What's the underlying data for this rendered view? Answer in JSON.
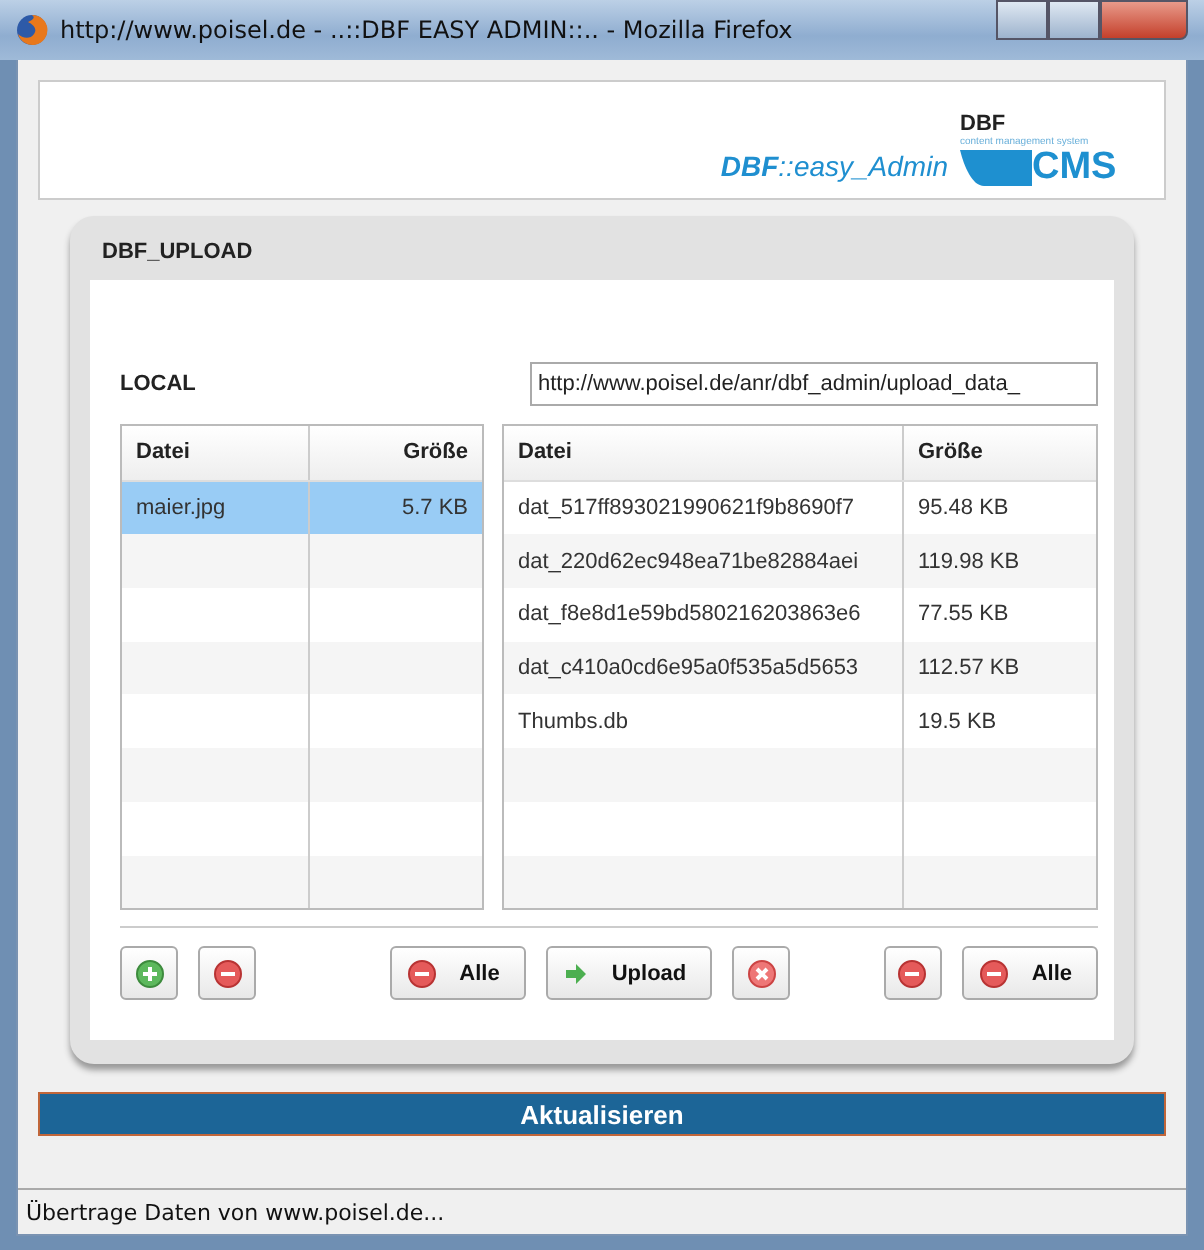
{
  "window": {
    "title": "http://www.poisel.de - ..::DBF EASY ADMIN::.. - Mozilla Firefox"
  },
  "header": {
    "product": "**DBF**::easy_Admin",
    "logo_top": "DBF",
    "logo_tagline": "content management system",
    "logo_main": "CMS"
  },
  "panel": {
    "title": "DBF_UPLOAD",
    "local_label": "LOCAL",
    "remote_path": "http://www.poisel.de/anr/dbf_admin/upload_data_",
    "local_table": {
      "columns": [
        "Datei",
        "Größe"
      ],
      "rows": [
        {
          "cells": [
            "maier.jpg",
            "5.7 KB"
          ],
          "selected": true
        }
      ]
    },
    "remote_table": {
      "columns": [
        "Datei",
        "Größe"
      ],
      "rows": [
        {
          "cells": [
            "dat_517ff893021990621f9b8690f7",
            "95.48 KB"
          ],
          "selected": false
        },
        {
          "cells": [
            "dat_220d62ec948ea71be82884aei",
            "119.98 KB"
          ],
          "selected": false
        },
        {
          "cells": [
            "dat_f8e8d1e59bd580216203863e6",
            "77.55 KB"
          ],
          "selected": false
        },
        {
          "cells": [
            "dat_c410a0cd6e95a0f535a5d5653",
            "112.57 KB"
          ],
          "selected": false
        },
        {
          "cells": [
            "Thumbs.db",
            "19.5 KB"
          ],
          "selected": false
        }
      ]
    },
    "button_groups": [
      [
        {
          "kind": "add"
        },
        {
          "kind": "remove"
        }
      ],
      [
        {
          "kind": "remove",
          "label": "Alle"
        },
        {
          "kind": "arrow",
          "label": "Upload"
        },
        {
          "kind": "cancel"
        }
      ],
      [
        {
          "kind": "remove"
        },
        {
          "kind": "remove",
          "label": "Alle"
        }
      ]
    ]
  },
  "update_button": "Aktualisieren",
  "status_bar": "Übertrage Daten von www.poisel.de..."
}
